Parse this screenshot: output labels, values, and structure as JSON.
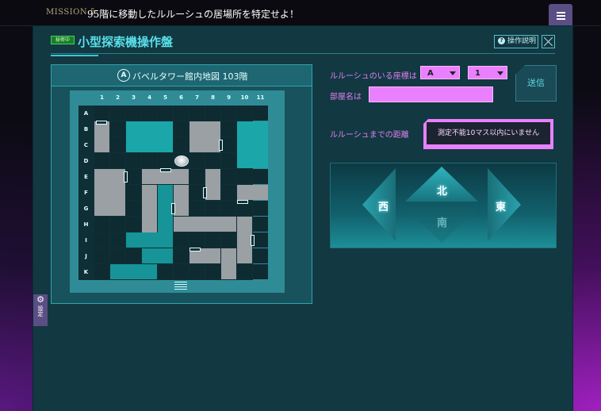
{
  "header": {
    "mission_no": "MISSION 5",
    "mission_title": "95階に移動したルルーシュの居場所を特定せよ！"
  },
  "panel": {
    "badge": "秘密中",
    "title": "小型探索機操作盤",
    "help_label": "操作説明"
  },
  "map": {
    "logo": "A",
    "title": "バベルタワー館内地図 103階",
    "columns": [
      "1",
      "2",
      "3",
      "4",
      "5",
      "6",
      "7",
      "8",
      "9",
      "10",
      "11"
    ],
    "rows": [
      "A",
      "B",
      "C",
      "D",
      "E",
      "F",
      "G",
      "H",
      "I",
      "J",
      "K"
    ]
  },
  "form": {
    "coord_label": "ルルーシュのいる座標は",
    "coord_col_value": "A",
    "coord_row_value": "1",
    "room_label": "部屋名は",
    "room_value": "",
    "send_label": "送信",
    "distance_label": "ルルーシュまでの距離",
    "distance_value": "測定不能10マス以内にいません"
  },
  "compass": {
    "north": "北",
    "south": "南",
    "west": "西",
    "east": "東"
  },
  "settings": {
    "label": "設定"
  },
  "colors": {
    "accent": "#59e0ea",
    "pink": "#e980ff",
    "panel": "#123842"
  }
}
